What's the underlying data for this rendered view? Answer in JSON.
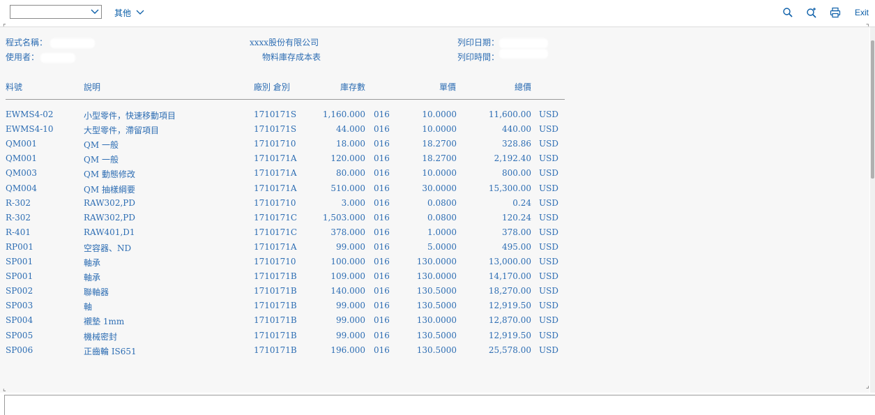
{
  "toolbar": {
    "dropdown_value": "",
    "more_label": "其他",
    "exit_label": "Exit",
    "icons": [
      "search-icon",
      "search-plus-icon",
      "print-icon"
    ]
  },
  "report": {
    "program_label": "程式名稱：",
    "user_label": "使用者：",
    "company": "xxxx股份有限公司",
    "report_title": "物料庫存成本表",
    "print_date_label": "列印日期：",
    "print_time_label": "列印時間：",
    "columns": {
      "material": "料號",
      "description": "說明",
      "plant_sloc": "廠別 倉別",
      "stock": "庫存數",
      "unit_price": "單價",
      "total": "總價"
    },
    "rows": [
      {
        "material": "EWMS4-02",
        "desc": "小型零件，快速移動項目",
        "plant": "1710",
        "sloc": "171S",
        "qty": "1,160.000",
        "unit": "016",
        "price": "10.0000",
        "total": "11,600.00",
        "cur": "USD"
      },
      {
        "material": "EWMS4-10",
        "desc": "大型零件，滯留項目",
        "plant": "1710",
        "sloc": "171S",
        "qty": "44.000",
        "unit": "016",
        "price": "10.0000",
        "total": "440.00",
        "cur": "USD"
      },
      {
        "material": "QM001",
        "desc": "QM 一般",
        "plant": "1710",
        "sloc": "1710",
        "qty": "18.000",
        "unit": "016",
        "price": "18.2700",
        "total": "328.86",
        "cur": "USD"
      },
      {
        "material": "QM001",
        "desc": "QM 一般",
        "plant": "1710",
        "sloc": "171A",
        "qty": "120.000",
        "unit": "016",
        "price": "18.2700",
        "total": "2,192.40",
        "cur": "USD"
      },
      {
        "material": "QM003",
        "desc": "QM 動態修改",
        "plant": "1710",
        "sloc": "171A",
        "qty": "80.000",
        "unit": "016",
        "price": "10.0000",
        "total": "800.00",
        "cur": "USD"
      },
      {
        "material": "QM004",
        "desc": "QM 抽樣綱要",
        "plant": "1710",
        "sloc": "171A",
        "qty": "510.000",
        "unit": "016",
        "price": "30.0000",
        "total": "15,300.00",
        "cur": "USD"
      },
      {
        "material": "R-302",
        "desc": "RAW302,PD",
        "plant": "1710",
        "sloc": "1710",
        "qty": "3.000",
        "unit": "016",
        "price": "0.0800",
        "total": "0.24",
        "cur": "USD"
      },
      {
        "material": "R-302",
        "desc": "RAW302,PD",
        "plant": "1710",
        "sloc": "171C",
        "qty": "1,503.000",
        "unit": "016",
        "price": "0.0800",
        "total": "120.24",
        "cur": "USD"
      },
      {
        "material": "R-401",
        "desc": "RAW401,D1",
        "plant": "1710",
        "sloc": "171C",
        "qty": "378.000",
        "unit": "016",
        "price": "1.0000",
        "total": "378.00",
        "cur": "USD"
      },
      {
        "material": "RP001",
        "desc": "空容器、ND",
        "plant": "1710",
        "sloc": "171A",
        "qty": "99.000",
        "unit": "016",
        "price": "5.0000",
        "total": "495.00",
        "cur": "USD"
      },
      {
        "material": "SP001",
        "desc": "軸承",
        "plant": "1710",
        "sloc": "1710",
        "qty": "100.000",
        "unit": "016",
        "price": "130.0000",
        "total": "13,000.00",
        "cur": "USD"
      },
      {
        "material": "SP001",
        "desc": "軸承",
        "plant": "1710",
        "sloc": "171B",
        "qty": "109.000",
        "unit": "016",
        "price": "130.0000",
        "total": "14,170.00",
        "cur": "USD"
      },
      {
        "material": "SP002",
        "desc": "聯軸器",
        "plant": "1710",
        "sloc": "171B",
        "qty": "140.000",
        "unit": "016",
        "price": "130.5000",
        "total": "18,270.00",
        "cur": "USD"
      },
      {
        "material": "SP003",
        "desc": "軸",
        "plant": "1710",
        "sloc": "171B",
        "qty": "99.000",
        "unit": "016",
        "price": "130.5000",
        "total": "12,919.50",
        "cur": "USD"
      },
      {
        "material": "SP004",
        "desc": "襯墊 1mm",
        "plant": "1710",
        "sloc": "171B",
        "qty": "99.000",
        "unit": "016",
        "price": "130.0000",
        "total": "12,870.00",
        "cur": "USD"
      },
      {
        "material": "SP005",
        "desc": "機械密封",
        "plant": "1710",
        "sloc": "171B",
        "qty": "99.000",
        "unit": "016",
        "price": "130.5000",
        "total": "12,919.50",
        "cur": "USD"
      },
      {
        "material": "SP006",
        "desc": "正齒輪 IS651",
        "plant": "1710",
        "sloc": "171B",
        "qty": "196.000",
        "unit": "016",
        "price": "130.5000",
        "total": "25,578.00",
        "cur": "USD"
      }
    ]
  },
  "command_field": {
    "value": ""
  }
}
